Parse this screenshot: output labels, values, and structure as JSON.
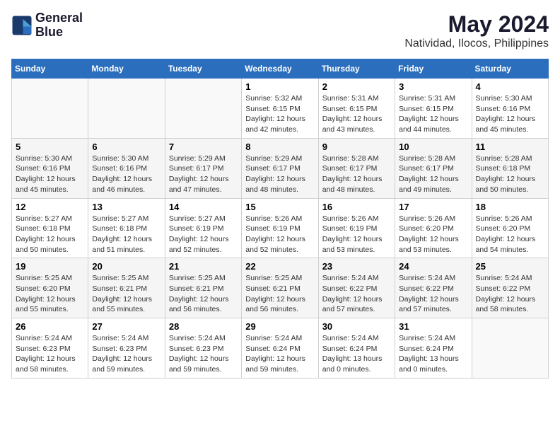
{
  "logo": {
    "line1": "General",
    "line2": "Blue"
  },
  "title": "May 2024",
  "location": "Natividad, Ilocos, Philippines",
  "weekdays": [
    "Sunday",
    "Monday",
    "Tuesday",
    "Wednesday",
    "Thursday",
    "Friday",
    "Saturday"
  ],
  "weeks": [
    [
      {
        "day": "",
        "info": ""
      },
      {
        "day": "",
        "info": ""
      },
      {
        "day": "",
        "info": ""
      },
      {
        "day": "1",
        "info": "Sunrise: 5:32 AM\nSunset: 6:15 PM\nDaylight: 12 hours\nand 42 minutes."
      },
      {
        "day": "2",
        "info": "Sunrise: 5:31 AM\nSunset: 6:15 PM\nDaylight: 12 hours\nand 43 minutes."
      },
      {
        "day": "3",
        "info": "Sunrise: 5:31 AM\nSunset: 6:15 PM\nDaylight: 12 hours\nand 44 minutes."
      },
      {
        "day": "4",
        "info": "Sunrise: 5:30 AM\nSunset: 6:16 PM\nDaylight: 12 hours\nand 45 minutes."
      }
    ],
    [
      {
        "day": "5",
        "info": "Sunrise: 5:30 AM\nSunset: 6:16 PM\nDaylight: 12 hours\nand 45 minutes."
      },
      {
        "day": "6",
        "info": "Sunrise: 5:30 AM\nSunset: 6:16 PM\nDaylight: 12 hours\nand 46 minutes."
      },
      {
        "day": "7",
        "info": "Sunrise: 5:29 AM\nSunset: 6:17 PM\nDaylight: 12 hours\nand 47 minutes."
      },
      {
        "day": "8",
        "info": "Sunrise: 5:29 AM\nSunset: 6:17 PM\nDaylight: 12 hours\nand 48 minutes."
      },
      {
        "day": "9",
        "info": "Sunrise: 5:28 AM\nSunset: 6:17 PM\nDaylight: 12 hours\nand 48 minutes."
      },
      {
        "day": "10",
        "info": "Sunrise: 5:28 AM\nSunset: 6:17 PM\nDaylight: 12 hours\nand 49 minutes."
      },
      {
        "day": "11",
        "info": "Sunrise: 5:28 AM\nSunset: 6:18 PM\nDaylight: 12 hours\nand 50 minutes."
      }
    ],
    [
      {
        "day": "12",
        "info": "Sunrise: 5:27 AM\nSunset: 6:18 PM\nDaylight: 12 hours\nand 50 minutes."
      },
      {
        "day": "13",
        "info": "Sunrise: 5:27 AM\nSunset: 6:18 PM\nDaylight: 12 hours\nand 51 minutes."
      },
      {
        "day": "14",
        "info": "Sunrise: 5:27 AM\nSunset: 6:19 PM\nDaylight: 12 hours\nand 52 minutes."
      },
      {
        "day": "15",
        "info": "Sunrise: 5:26 AM\nSunset: 6:19 PM\nDaylight: 12 hours\nand 52 minutes."
      },
      {
        "day": "16",
        "info": "Sunrise: 5:26 AM\nSunset: 6:19 PM\nDaylight: 12 hours\nand 53 minutes."
      },
      {
        "day": "17",
        "info": "Sunrise: 5:26 AM\nSunset: 6:20 PM\nDaylight: 12 hours\nand 53 minutes."
      },
      {
        "day": "18",
        "info": "Sunrise: 5:26 AM\nSunset: 6:20 PM\nDaylight: 12 hours\nand 54 minutes."
      }
    ],
    [
      {
        "day": "19",
        "info": "Sunrise: 5:25 AM\nSunset: 6:20 PM\nDaylight: 12 hours\nand 55 minutes."
      },
      {
        "day": "20",
        "info": "Sunrise: 5:25 AM\nSunset: 6:21 PM\nDaylight: 12 hours\nand 55 minutes."
      },
      {
        "day": "21",
        "info": "Sunrise: 5:25 AM\nSunset: 6:21 PM\nDaylight: 12 hours\nand 56 minutes."
      },
      {
        "day": "22",
        "info": "Sunrise: 5:25 AM\nSunset: 6:21 PM\nDaylight: 12 hours\nand 56 minutes."
      },
      {
        "day": "23",
        "info": "Sunrise: 5:24 AM\nSunset: 6:22 PM\nDaylight: 12 hours\nand 57 minutes."
      },
      {
        "day": "24",
        "info": "Sunrise: 5:24 AM\nSunset: 6:22 PM\nDaylight: 12 hours\nand 57 minutes."
      },
      {
        "day": "25",
        "info": "Sunrise: 5:24 AM\nSunset: 6:22 PM\nDaylight: 12 hours\nand 58 minutes."
      }
    ],
    [
      {
        "day": "26",
        "info": "Sunrise: 5:24 AM\nSunset: 6:23 PM\nDaylight: 12 hours\nand 58 minutes."
      },
      {
        "day": "27",
        "info": "Sunrise: 5:24 AM\nSunset: 6:23 PM\nDaylight: 12 hours\nand 59 minutes."
      },
      {
        "day": "28",
        "info": "Sunrise: 5:24 AM\nSunset: 6:23 PM\nDaylight: 12 hours\nand 59 minutes."
      },
      {
        "day": "29",
        "info": "Sunrise: 5:24 AM\nSunset: 6:24 PM\nDaylight: 12 hours\nand 59 minutes."
      },
      {
        "day": "30",
        "info": "Sunrise: 5:24 AM\nSunset: 6:24 PM\nDaylight: 13 hours\nand 0 minutes."
      },
      {
        "day": "31",
        "info": "Sunrise: 5:24 AM\nSunset: 6:24 PM\nDaylight: 13 hours\nand 0 minutes."
      },
      {
        "day": "",
        "info": ""
      }
    ]
  ]
}
